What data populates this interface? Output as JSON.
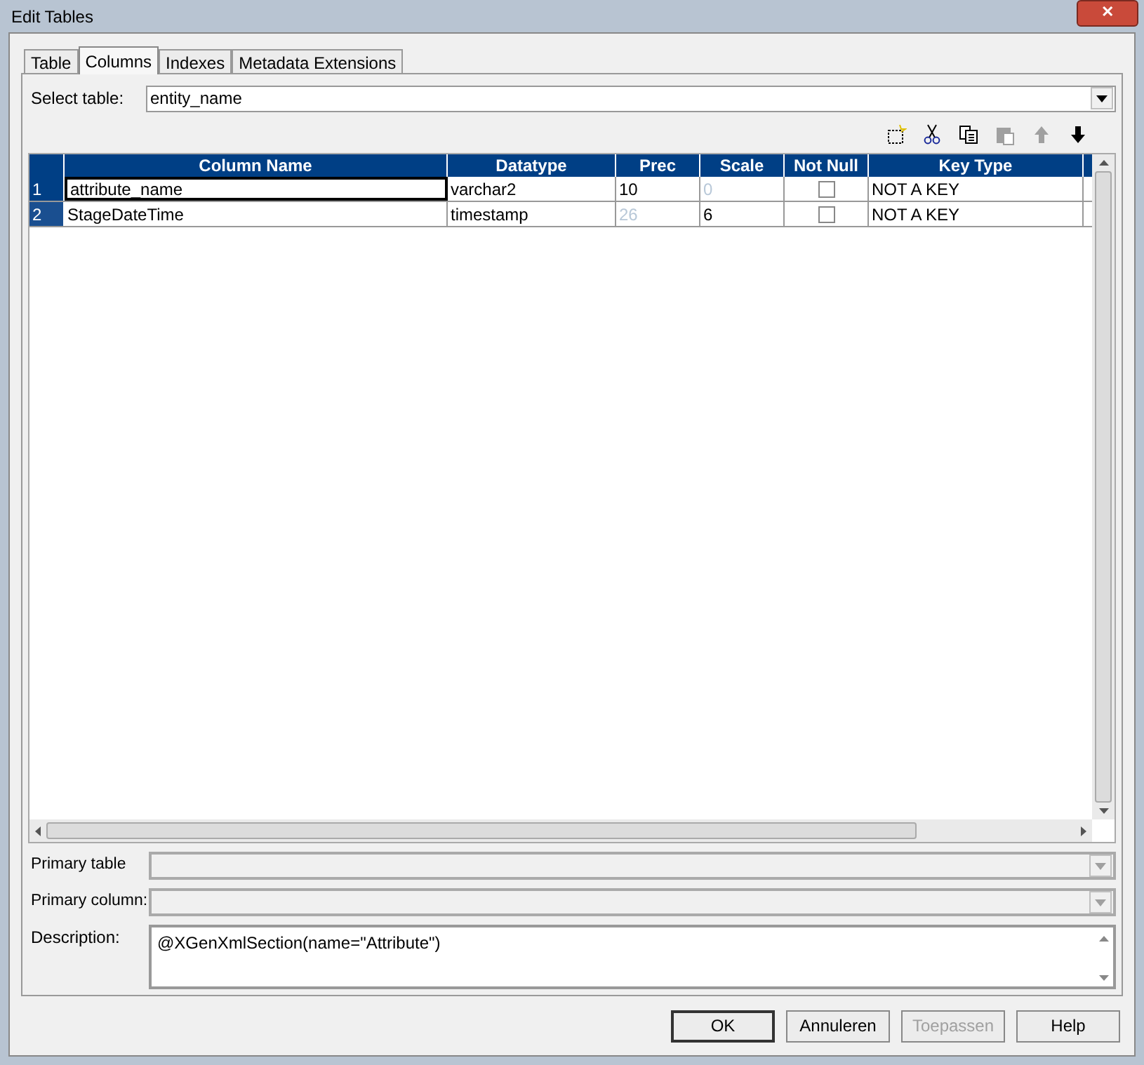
{
  "window": {
    "title": "Edit Tables",
    "close": "✕"
  },
  "tabs": [
    {
      "label": "Table",
      "selected": false
    },
    {
      "label": "Columns",
      "selected": true
    },
    {
      "label": "Indexes",
      "selected": false
    },
    {
      "label": "Metadata Extensions",
      "selected": false
    }
  ],
  "select_table": {
    "label": "Select table:",
    "value": "entity_name"
  },
  "toolbar": [
    {
      "kind": "new",
      "disabled": false
    },
    {
      "kind": "cut",
      "disabled": false
    },
    {
      "kind": "copy",
      "disabled": false
    },
    {
      "kind": "paste",
      "disabled": true
    },
    {
      "kind": "up",
      "disabled": true
    },
    {
      "kind": "down",
      "disabled": false
    }
  ],
  "table": {
    "columns": [
      "Column Name",
      "Datatype",
      "Prec",
      "Scale",
      "Not Null",
      "Key Type"
    ],
    "rows": [
      {
        "number": "1",
        "selected": true,
        "column_name": "attribute_name",
        "datatype": "varchar2",
        "prec": {
          "text": "10",
          "disabled": false
        },
        "scale": {
          "text": "0",
          "disabled": true
        },
        "not_null": false,
        "key_type": "NOT A KEY"
      },
      {
        "number": "2",
        "selected": false,
        "column_name": "StageDateTime",
        "datatype": "timestamp",
        "prec": {
          "text": "26",
          "disabled": true
        },
        "scale": {
          "text": "6",
          "disabled": false
        },
        "not_null": false,
        "key_type": "NOT A KEY"
      }
    ]
  },
  "primary_table": {
    "label": "Primary table",
    "disabled": true
  },
  "primary_column": {
    "label": "Primary column:",
    "disabled": true
  },
  "description": {
    "label": "Description:",
    "value": "@XGenXmlSection(name=\"Attribute\")"
  },
  "buttons": [
    {
      "label": "OK",
      "disabled": false,
      "default": true
    },
    {
      "label": "Annuleren",
      "disabled": false,
      "default": false
    },
    {
      "label": "Toepassen",
      "disabled": true,
      "default": false
    },
    {
      "label": "Help",
      "disabled": false,
      "default": false
    }
  ]
}
